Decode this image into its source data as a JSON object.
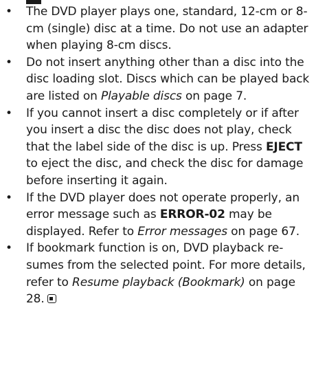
{
  "notes": [
    {
      "text": "The DVD player plays one, standard, 12-cm or 8-cm (single) disc at a time. Do not use an adapter when playing 8-cm discs."
    },
    {
      "text1": "Do not insert anything other than a disc into the disc loading slot. Discs which can be played back are listed on ",
      "ref": "Playable discs",
      "text2": " on page 7."
    },
    {
      "text1": "If you cannot insert a disc completely or if after you insert a disc the disc does not play, check that the label side of the disc is up. Press ",
      "bold": "EJECT",
      "text2": " to eject the disc, and check the disc for damage before inserting it again."
    },
    {
      "text1": "If the DVD player does not operate properly, an error message such as ",
      "bold": "ERROR-02",
      "text2": " may be displayed. Refer to ",
      "ref": "Error messages",
      "text3": " on page 67."
    },
    {
      "text1": "If bookmark function is on, DVD playback re­sumes from the selected point. For more de­tails, refer to ",
      "ref": "Resume playback (Bookmark)",
      "text2": " on page 28."
    }
  ],
  "bullet": "•",
  "end_mark_icon": "end-of-section-mark"
}
